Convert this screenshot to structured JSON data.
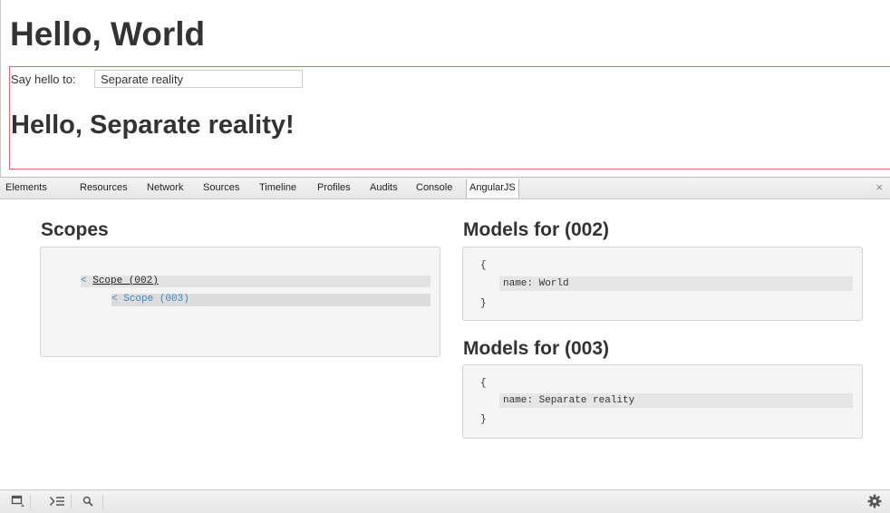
{
  "page": {
    "heading": "Hello, World",
    "input_label": "Say hello to:",
    "input_value": "Separate reality",
    "greeting": "Hello, Separate reality!"
  },
  "devtools": {
    "tabs": [
      "Elements",
      "Resources",
      "Network",
      "Sources",
      "Timeline",
      "Profiles",
      "Audits",
      "Console",
      "AngularJS"
    ],
    "active_tab": "AngularJS",
    "close_glyph": "×",
    "scopes": {
      "title": "Scopes",
      "tree": [
        {
          "caret": "<",
          "label": "Scope (002)"
        },
        {
          "caret": "<",
          "label": "Scope (003)"
        }
      ]
    },
    "models": [
      {
        "title": "Models for (002)",
        "open": "{",
        "prop": "name: World",
        "close": "}"
      },
      {
        "title": "Models for (003)",
        "open": "{",
        "prop": "name: Separate reality",
        "close": "}"
      }
    ]
  },
  "statusbar": {
    "icons": [
      "dock-icon",
      "console-drawer-icon",
      "search-icon",
      "settings-gear-icon"
    ]
  },
  "colors": {
    "scope_border": "#e06a6a",
    "link_blue": "#3a87c8"
  }
}
